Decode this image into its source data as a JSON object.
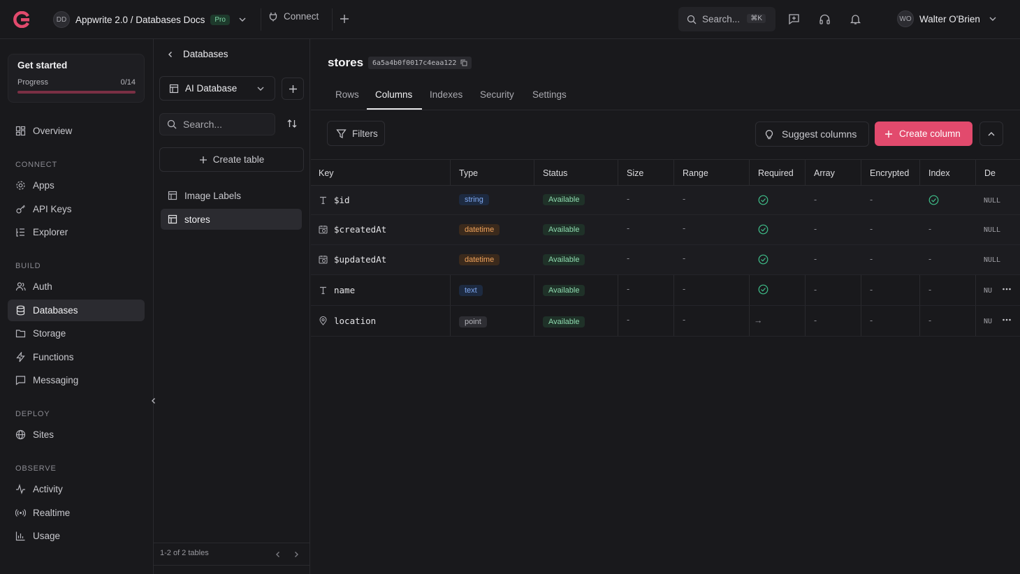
{
  "topbar": {
    "project_initials": "DD",
    "project_name": "Appwrite 2.0 / Databases Docs",
    "plan_badge": "Pro",
    "connect_label": "Connect",
    "search_placeholder": "Search...",
    "search_shortcut": "⌘K",
    "user_initials": "WO",
    "user_name": "Walter O'Brien"
  },
  "sidebar": {
    "get_started": {
      "title": "Get started",
      "progress_label": "Progress",
      "progress_count": "0/14",
      "progress_fraction": 0
    },
    "overview": "Overview",
    "sections": [
      {
        "heading": "CONNECT",
        "items": [
          "Apps",
          "API Keys",
          "Explorer"
        ]
      },
      {
        "heading": "BUILD",
        "items": [
          "Auth",
          "Databases",
          "Storage",
          "Functions",
          "Messaging"
        ]
      },
      {
        "heading": "DEPLOY",
        "items": [
          "Sites"
        ]
      },
      {
        "heading": "OBSERVE",
        "items": [
          "Activity",
          "Realtime",
          "Usage"
        ]
      }
    ],
    "active_item": "Databases"
  },
  "tables_panel": {
    "back_label": "Databases",
    "database_name": "AI Database",
    "search_placeholder": "Search...",
    "create_table_label": "Create table",
    "tables": [
      "Image Labels",
      "stores"
    ],
    "active_table": "stores",
    "footer": "1-2 of 2 tables"
  },
  "main": {
    "title": "stores",
    "table_id": "6a5a4b0f0017c4eaa122",
    "tabs": [
      "Rows",
      "Columns",
      "Indexes",
      "Security",
      "Settings"
    ],
    "active_tab": "Columns",
    "filters_label": "Filters",
    "suggest_label": "Suggest columns",
    "create_column_label": "Create column",
    "columns": [
      "Key",
      "Type",
      "Status",
      "Size",
      "Range",
      "Required",
      "Array",
      "Encrypted",
      "Index",
      "De"
    ],
    "rows": [
      {
        "key": "$id",
        "icon": "text-type-icon",
        "type": "string",
        "status": "Available",
        "size": "-",
        "range": "-",
        "required": true,
        "array": "-",
        "encrypted": "-",
        "index": true,
        "default": "NULL"
      },
      {
        "key": "$createdAt",
        "icon": "calendar-clock-icon",
        "type": "datetime",
        "status": "Available",
        "size": "-",
        "range": "-",
        "required": true,
        "array": "-",
        "encrypted": "-",
        "index": "-",
        "default": "NULL"
      },
      {
        "key": "$updatedAt",
        "icon": "calendar-clock-icon",
        "type": "datetime",
        "status": "Available",
        "size": "-",
        "range": "-",
        "required": true,
        "array": "-",
        "encrypted": "-",
        "index": "-",
        "default": "NULL"
      },
      {
        "key": "name",
        "icon": "text-type-icon",
        "type": "text",
        "status": "Available",
        "size": "-",
        "range": "-",
        "required": true,
        "array": "-",
        "encrypted": "-",
        "index": "-",
        "default": "NU"
      },
      {
        "key": "location",
        "icon": "map-pin-icon",
        "type": "point",
        "status": "Available",
        "size": "-",
        "range": "-",
        "required": "→",
        "array": "-",
        "encrypted": "-",
        "index": "-",
        "default": "NU"
      }
    ]
  },
  "colors": {
    "accent": "#e24a6d",
    "bg": "#19191c",
    "available": "#8fdcb0",
    "check": "#3fbf8a"
  }
}
